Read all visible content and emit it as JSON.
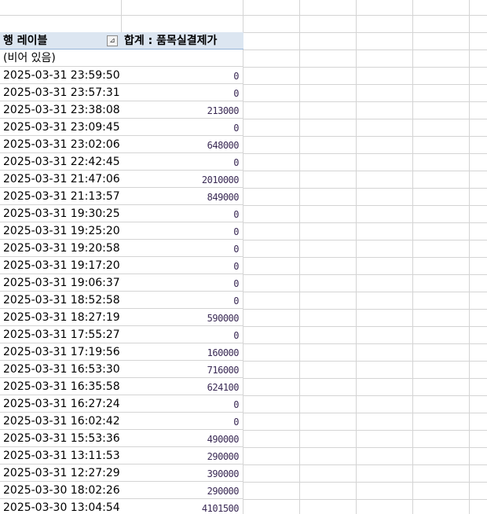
{
  "pivot": {
    "row_label_header": "행 레이블",
    "sum_header": "합계 : 품목실결제가",
    "rows": [
      {
        "label": "(비어 있음)",
        "value": ""
      },
      {
        "label": "2025-03-31 23:59:50",
        "value": "0"
      },
      {
        "label": "2025-03-31 23:57:31",
        "value": "0"
      },
      {
        "label": "2025-03-31 23:38:08",
        "value": "213000"
      },
      {
        "label": "2025-03-31 23:09:45",
        "value": "0"
      },
      {
        "label": "2025-03-31 23:02:06",
        "value": "648000"
      },
      {
        "label": "2025-03-31 22:42:45",
        "value": "0"
      },
      {
        "label": "2025-03-31 21:47:06",
        "value": "2010000"
      },
      {
        "label": "2025-03-31 21:13:57",
        "value": "849000"
      },
      {
        "label": "2025-03-31 19:30:25",
        "value": "0"
      },
      {
        "label": "2025-03-31 19:25:20",
        "value": "0"
      },
      {
        "label": "2025-03-31 19:20:58",
        "value": "0"
      },
      {
        "label": "2025-03-31 19:17:20",
        "value": "0"
      },
      {
        "label": "2025-03-31 19:06:37",
        "value": "0"
      },
      {
        "label": "2025-03-31 18:52:58",
        "value": "0"
      },
      {
        "label": "2025-03-31 18:27:19",
        "value": "590000"
      },
      {
        "label": "2025-03-31 17:55:27",
        "value": "0"
      },
      {
        "label": "2025-03-31 17:19:56",
        "value": "160000"
      },
      {
        "label": "2025-03-31 16:53:30",
        "value": "716000"
      },
      {
        "label": "2025-03-31 16:35:58",
        "value": "624100"
      },
      {
        "label": "2025-03-31 16:27:24",
        "value": "0"
      },
      {
        "label": "2025-03-31 16:02:42",
        "value": "0"
      },
      {
        "label": "2025-03-31 15:53:36",
        "value": "490000"
      },
      {
        "label": "2025-03-31 13:11:53",
        "value": "290000"
      },
      {
        "label": "2025-03-31 12:27:29",
        "value": "390000"
      },
      {
        "label": "2025-03-30 18:02:26",
        "value": "290000"
      },
      {
        "label": "2025-03-30 13:04:54",
        "value": "4101500"
      }
    ]
  }
}
